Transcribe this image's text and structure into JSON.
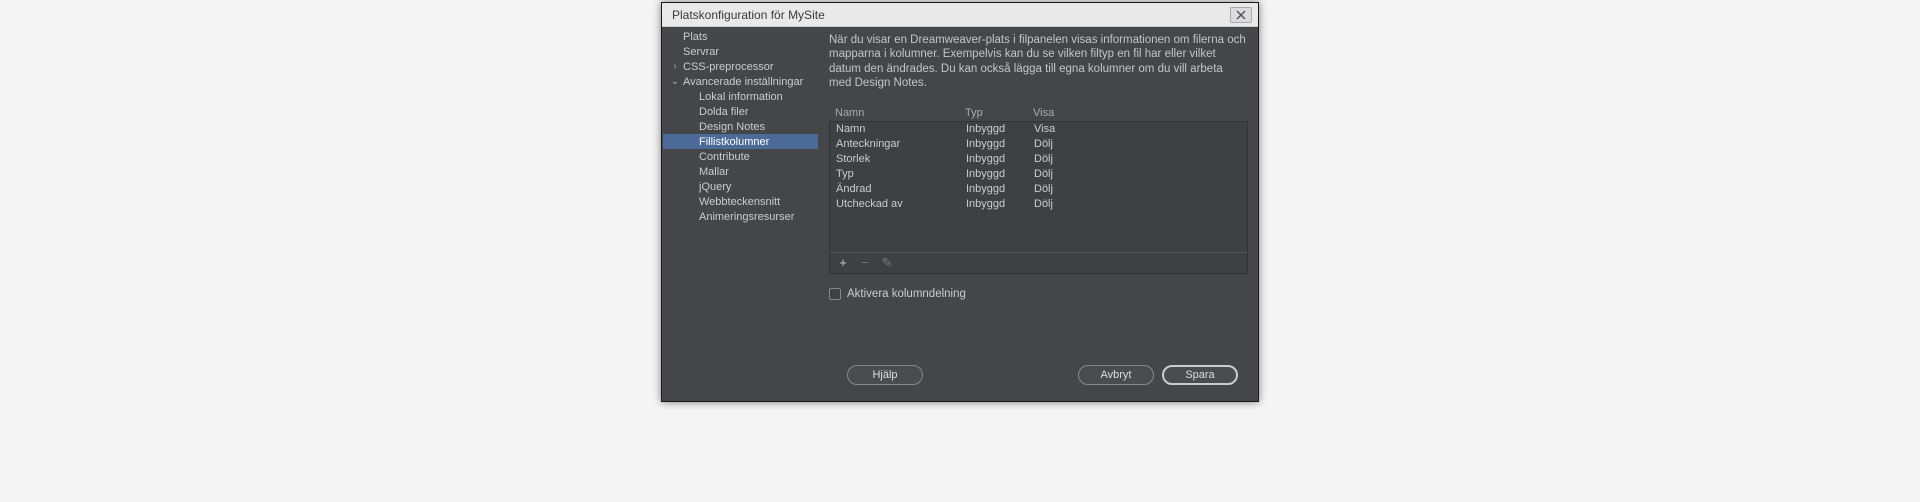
{
  "title": "Platskonfiguration för MySite",
  "sidebar": {
    "items": [
      {
        "label": "Plats",
        "level": 1,
        "caret": ""
      },
      {
        "label": "Servrar",
        "level": 1,
        "caret": ""
      },
      {
        "label": "CSS-preprocessor",
        "level": 1,
        "caret": "right"
      },
      {
        "label": "Avancerade inställningar",
        "level": 1,
        "caret": "down"
      },
      {
        "label": "Lokal information",
        "level": 2,
        "caret": ""
      },
      {
        "label": "Dolda filer",
        "level": 2,
        "caret": ""
      },
      {
        "label": "Design Notes",
        "level": 2,
        "caret": ""
      },
      {
        "label": "Fillistkolumner",
        "level": 2,
        "caret": "",
        "selected": true
      },
      {
        "label": "Contribute",
        "level": 2,
        "caret": ""
      },
      {
        "label": "Mallar",
        "level": 2,
        "caret": ""
      },
      {
        "label": "jQuery",
        "level": 2,
        "caret": ""
      },
      {
        "label": "Webbteckensnitt",
        "level": 2,
        "caret": ""
      },
      {
        "label": "Animeringsresurser",
        "level": 2,
        "caret": ""
      }
    ]
  },
  "description": "När du visar en Dreamweaver-plats i filpanelen visas informationen om filerna och mapparna i kolumner. Exempelvis kan du se vilken filtyp en fil har eller vilket datum den ändrades. Du kan också lägga till egna kolumner om du vill arbeta med Design Notes.",
  "columns": {
    "headers": {
      "name": "Namn",
      "type": "Typ",
      "show": "Visa"
    },
    "rows": [
      {
        "name": "Namn",
        "type": "Inbyggd",
        "show": "Visa"
      },
      {
        "name": "Anteckningar",
        "type": "Inbyggd",
        "show": "Dölj"
      },
      {
        "name": "Storlek",
        "type": "Inbyggd",
        "show": "Dölj"
      },
      {
        "name": "Typ",
        "type": "Inbyggd",
        "show": "Dölj"
      },
      {
        "name": "Ändrad",
        "type": "Inbyggd",
        "show": "Dölj"
      },
      {
        "name": "Utcheckad av",
        "type": "Inbyggd",
        "show": "Dölj"
      }
    ]
  },
  "checkbox": {
    "label": "Aktivera kolumndelning",
    "checked": false
  },
  "buttons": {
    "help": "Hjälp",
    "cancel": "Avbryt",
    "save": "Spara"
  }
}
